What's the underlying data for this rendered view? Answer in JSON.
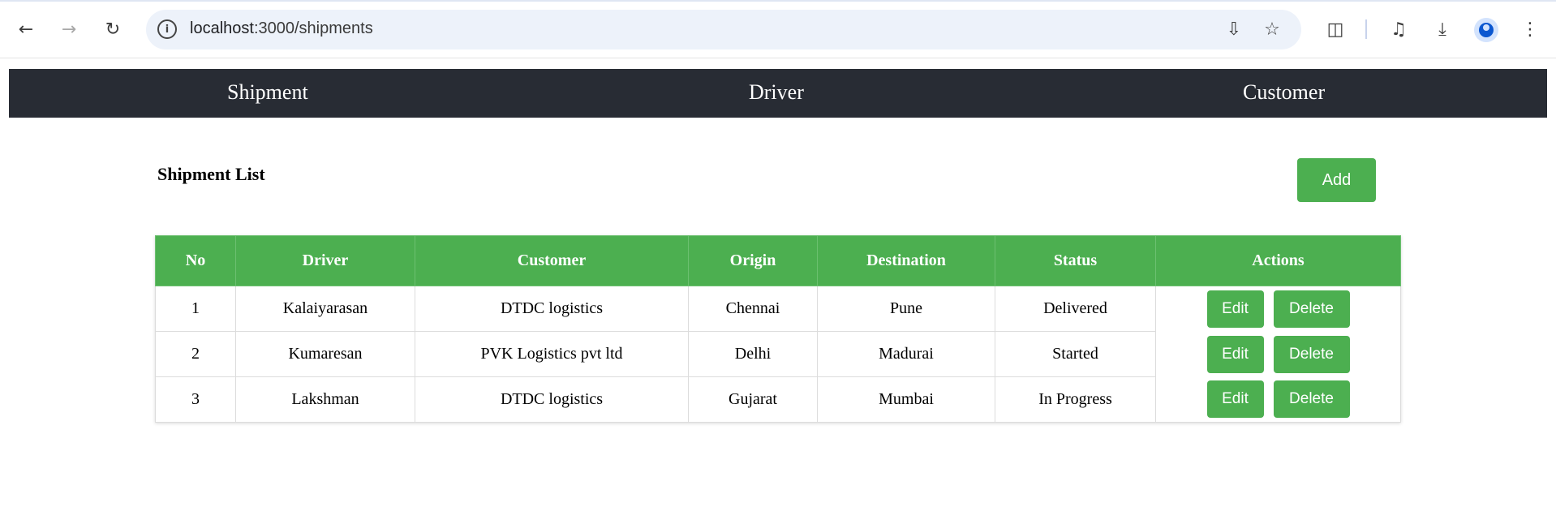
{
  "browser": {
    "url_host": "localhost",
    "url_path": ":3000/shipments",
    "icons": [
      "back-icon",
      "forward-icon",
      "reload-icon",
      "site-info-icon",
      "install-app-icon",
      "bookmark-star-icon",
      "extensions-icon",
      "media-queue-icon",
      "download-icon",
      "profile-icon",
      "more-menu-icon"
    ]
  },
  "navbar": {
    "items": [
      {
        "label": "Shipment"
      },
      {
        "label": "Driver"
      },
      {
        "label": "Customer"
      }
    ],
    "background": "#282c34"
  },
  "main": {
    "title": "Shipment List",
    "add_label": "Add",
    "accent": "#4caf50"
  },
  "table": {
    "headers": [
      "No",
      "Driver",
      "Customer",
      "Origin",
      "Destination",
      "Status",
      "Actions"
    ],
    "rows": [
      {
        "no": "1",
        "driver": "Kalaiyarasan",
        "customer": "DTDC logistics",
        "origin": "Chennai",
        "destination": "Pune",
        "status": "Delivered",
        "edit": "Edit",
        "delete": "Delete"
      },
      {
        "no": "2",
        "driver": "Kumaresan",
        "customer": "PVK Logistics pvt ltd",
        "origin": "Delhi",
        "destination": "Madurai",
        "status": "Started",
        "edit": "Edit",
        "delete": "Delete"
      },
      {
        "no": "3",
        "driver": "Lakshman",
        "customer": "DTDC logistics",
        "origin": "Gujarat",
        "destination": "Mumbai",
        "status": "In Progress",
        "edit": "Edit",
        "delete": "Delete"
      }
    ]
  }
}
